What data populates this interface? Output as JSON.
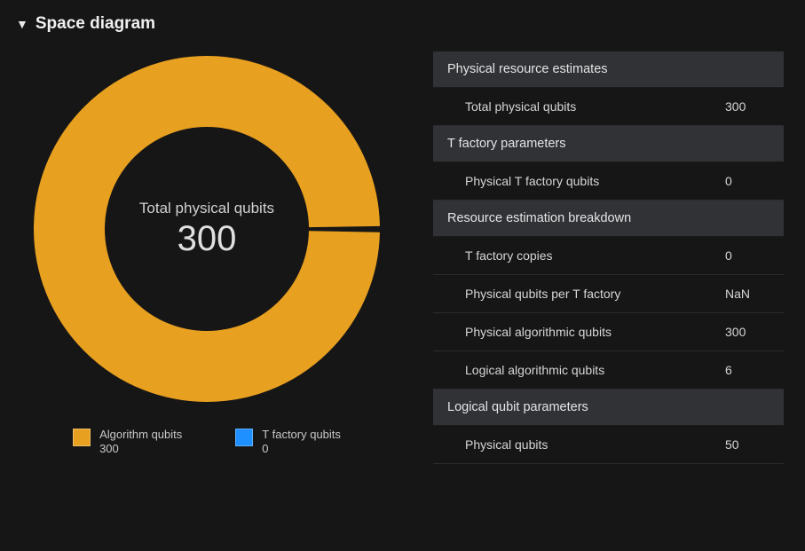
{
  "title": "Space diagram",
  "donut": {
    "center_label": "Total physical qubits",
    "center_value": "300"
  },
  "legend": {
    "items": [
      {
        "name": "Algorithm qubits",
        "value": "300",
        "color": "#e8a020"
      },
      {
        "name": "T factory qubits",
        "value": "0",
        "color": "#1e90ff"
      }
    ]
  },
  "table": {
    "sections": [
      {
        "header": "Physical resource estimates",
        "rows": [
          {
            "label": "Total physical qubits",
            "value": "300"
          }
        ]
      },
      {
        "header": "T factory parameters",
        "rows": [
          {
            "label": "Physical T factory qubits",
            "value": "0"
          }
        ]
      },
      {
        "header": "Resource estimation breakdown",
        "rows": [
          {
            "label": "T factory copies",
            "value": "0"
          },
          {
            "label": "Physical qubits per T factory",
            "value": "NaN"
          },
          {
            "label": "Physical algorithmic qubits",
            "value": "300"
          },
          {
            "label": "Logical algorithmic qubits",
            "value": "6"
          }
        ]
      },
      {
        "header": "Logical qubit parameters",
        "rows": [
          {
            "label": "Physical qubits",
            "value": "50"
          }
        ]
      }
    ]
  },
  "chart_data": {
    "type": "pie",
    "title": "Total physical qubits",
    "total": 300,
    "series": [
      {
        "name": "Algorithm qubits",
        "value": 300,
        "color": "#e8a020"
      },
      {
        "name": "T factory qubits",
        "value": 0,
        "color": "#1e90ff"
      }
    ]
  }
}
